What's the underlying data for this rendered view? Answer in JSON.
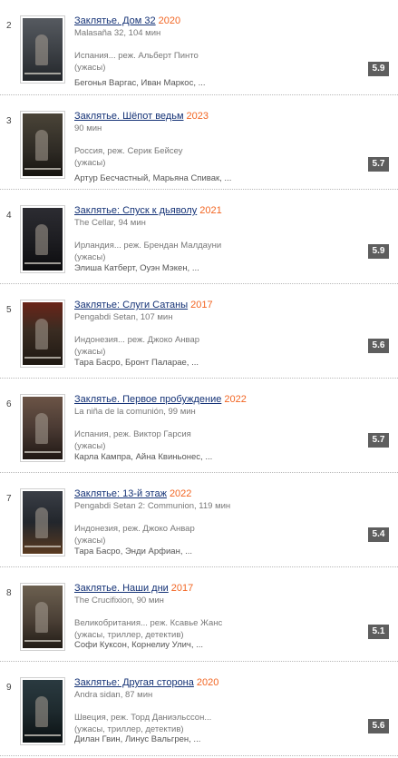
{
  "items": [
    {
      "num": "2",
      "title": "Заклятье. Дом 32",
      "year": "2020",
      "orig": "Malasaña 32, 104 мин",
      "country": "Испания... реж. Альберт Пинто",
      "genre": "(ужасы)",
      "cast": "Бегонья Варгас, Иван Маркос, ...",
      "rating": "5.9"
    },
    {
      "num": "3",
      "title": "Заклятье. Шёпот ведьм",
      "year": "2023",
      "orig": "90 мин",
      "country": "Россия, реж. Серик Бейсеу",
      "genre": "(ужасы)",
      "cast": "Артур Бесчастный, Марьяна Спивак, ...",
      "rating": "5.7"
    },
    {
      "num": "4",
      "title": "Заклятье: Спуск к дьяволу",
      "year": "2021",
      "orig": "The Cellar, 94 мин",
      "country": "Ирландия... реж. Брендан Малдауни",
      "genre": "(ужасы)",
      "cast": "Элиша Катберт, Оуэн Мэкен, ...",
      "rating": "5.9"
    },
    {
      "num": "5",
      "title": "Заклятье: Слуги Сатаны",
      "year": "2017",
      "orig": "Pengabdi Setan, 107 мин",
      "country": "Индонезия... реж. Джоко Анвар",
      "genre": "(ужасы)",
      "cast": "Тара Басро, Бронт Паларае, ...",
      "rating": "5.6"
    },
    {
      "num": "6",
      "title": "Заклятье. Первое пробуждение",
      "year": "2022",
      "orig": "La niña de la comunión, 99 мин",
      "country": "Испания, реж. Виктор Гарсия",
      "genre": "(ужасы)",
      "cast": "Карла Кампра, Айна Квиньонес, ...",
      "rating": "5.7"
    },
    {
      "num": "7",
      "title": "Заклятье: 13-й этаж",
      "year": "2022",
      "orig": "Pengabdi Setan 2: Communion, 119 мин",
      "country": "Индонезия, реж. Джоко Анвар",
      "genre": "(ужасы)",
      "cast": "Тара Басро, Энди Арфиан, ...",
      "rating": "5.4"
    },
    {
      "num": "8",
      "title": "Заклятье. Наши дни",
      "year": "2017",
      "orig": "The Crucifixion, 90 мин",
      "country": "Великобритания... реж. Ксавье Жанс",
      "genre": "(ужасы, триллер, детектив)",
      "cast": "Софи Куксон, Корнелиу Улич, ...",
      "rating": "5.1"
    },
    {
      "num": "9",
      "title": "Заклятье: Другая сторона",
      "year": "2020",
      "orig": "Andra sidan, 87 мин",
      "country": "Швеция, реж. Торд Даниэльссон...",
      "genre": "(ужасы, триллер, детектив)",
      "cast": "Дилан Гвин, Линус Вальгрен, ...",
      "rating": "5.6"
    }
  ],
  "poster_colors": [
    "#3b3f44",
    "#2e2a24",
    "#1c1c20",
    "#3a2c22",
    "#4a3a33",
    "#22262c",
    "#4b4036",
    "#1e2a2e"
  ],
  "poster_icon": "movie-poster"
}
